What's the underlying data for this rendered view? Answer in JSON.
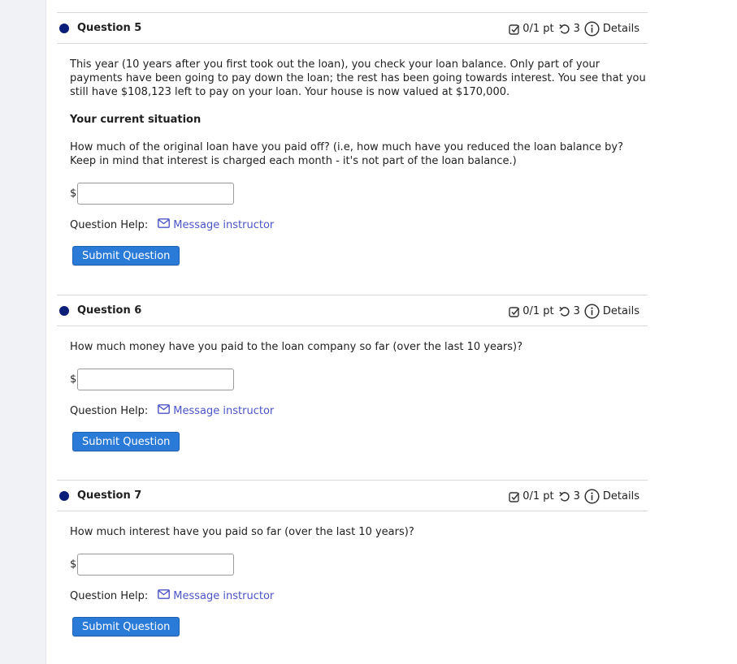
{
  "questions": [
    {
      "title": "Question 5",
      "score": "0/1 pt",
      "attempts": "3",
      "details_label": "Details",
      "paragraphs": [
        "This year (10 years after you first took out the loan), you check your loan balance. Only part of your payments have been going to pay down the loan; the rest has been going towards interest. You see that you still have $108,123 left to pay on your loan. Your house is now valued at $170,000."
      ],
      "subheading": "Your current situation",
      "prompt": "How much of the original loan have you paid off? (i.e, how much have you reduced the loan balance by? Keep in mind that interest is charged each month - it's not part of the loan balance.)",
      "currency": "$",
      "answer_value": "",
      "help_label": "Question Help:",
      "message_label": "Message instructor",
      "submit_label": "Submit Question"
    },
    {
      "title": "Question 6",
      "score": "0/1 pt",
      "attempts": "3",
      "details_label": "Details",
      "prompt": "How much money have you paid to the loan company so far (over the last 10 years)?",
      "currency": "$",
      "answer_value": "",
      "help_label": "Question Help:",
      "message_label": "Message instructor",
      "submit_label": "Submit Question"
    },
    {
      "title": "Question 7",
      "score": "0/1 pt",
      "attempts": "3",
      "details_label": "Details",
      "prompt": "How much interest have you paid so far (over the last 10 years)?",
      "currency": "$",
      "answer_value": "",
      "help_label": "Question Help:",
      "message_label": "Message instructor",
      "submit_label": "Submit Question"
    }
  ],
  "colors": {
    "dot": "#0b1f7a",
    "link": "#4b54c7",
    "button": "#2a7ad8"
  },
  "icons": {
    "score": "checkbox-icon",
    "attempts": "retry-icon",
    "details": "info-icon",
    "message": "mail-icon"
  }
}
